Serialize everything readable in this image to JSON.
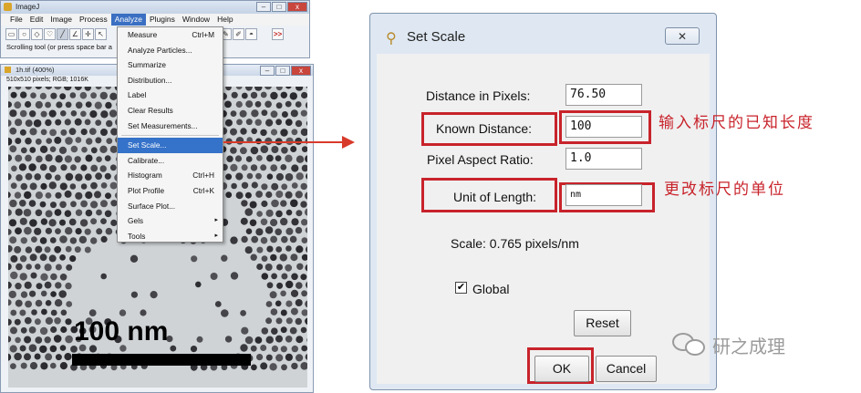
{
  "imagej": {
    "title": "ImageJ",
    "menus": [
      "File",
      "Edit",
      "Image",
      "Process",
      "Analyze",
      "Plugins",
      "Window",
      "Help"
    ],
    "active_menu": "Analyze",
    "toolbar_icons": [
      "rectangle-tool-icon",
      "oval-tool-icon",
      "polygon-tool-icon",
      "freehand-tool-icon",
      "line-tool-icon",
      "angle-tool-icon",
      "point-tool-icon",
      "wand-tool-icon",
      "pencil-tool-icon",
      "brush-tool-icon",
      "flood-fill-tool-icon",
      "more-tools-icon"
    ],
    "more_label": ">>",
    "status": "Scrolling tool (or press space bar a"
  },
  "image_window": {
    "title": "1h.tif (400%)",
    "info": "510x510 pixels; RGB; 1016K",
    "scale_label": "100 nm"
  },
  "analyze_menu": {
    "items": [
      {
        "label": "Measure",
        "shortcut": "Ctrl+M"
      },
      {
        "label": "Analyze Particles..."
      },
      {
        "label": "Summarize"
      },
      {
        "label": "Distribution..."
      },
      {
        "label": "Label"
      },
      {
        "label": "Clear Results"
      },
      {
        "label": "Set Measurements..."
      },
      {
        "label": "Set Scale..."
      },
      {
        "label": "Calibrate..."
      },
      {
        "label": "Histogram",
        "shortcut": "Ctrl+H"
      },
      {
        "label": "Plot Profile",
        "shortcut": "Ctrl+K"
      },
      {
        "label": "Surface Plot..."
      },
      {
        "label": "Gels",
        "submenu": "▸"
      },
      {
        "label": "Tools",
        "submenu": "▸"
      }
    ]
  },
  "set_scale": {
    "title": "Set Scale",
    "close_symbol": "✕",
    "distance_in_pixels_label": "Distance in Pixels:",
    "distance_in_pixels": "76.50",
    "known_distance_label": "Known Distance:",
    "known_distance": "100",
    "pixel_aspect_ratio_label": "Pixel Aspect Ratio:",
    "pixel_aspect_ratio": "1.0",
    "unit_of_length_label": "Unit of Length:",
    "unit_of_length": "nm",
    "scale_text": "Scale: 0.765 pixels/nm",
    "global_label": "Global",
    "global_checked": "✔",
    "reset_label": "Reset",
    "ok_label": "OK",
    "cancel_label": "Cancel"
  },
  "annotations": {
    "known_distance_note": "输入标尺的已知长度",
    "unit_note": "更改标尺的单位",
    "watermark": "研之成理"
  },
  "colors": {
    "highlight_red": "#c8232b",
    "arrow_red": "#d83a2a",
    "menu_highlight": "#3572c9"
  }
}
